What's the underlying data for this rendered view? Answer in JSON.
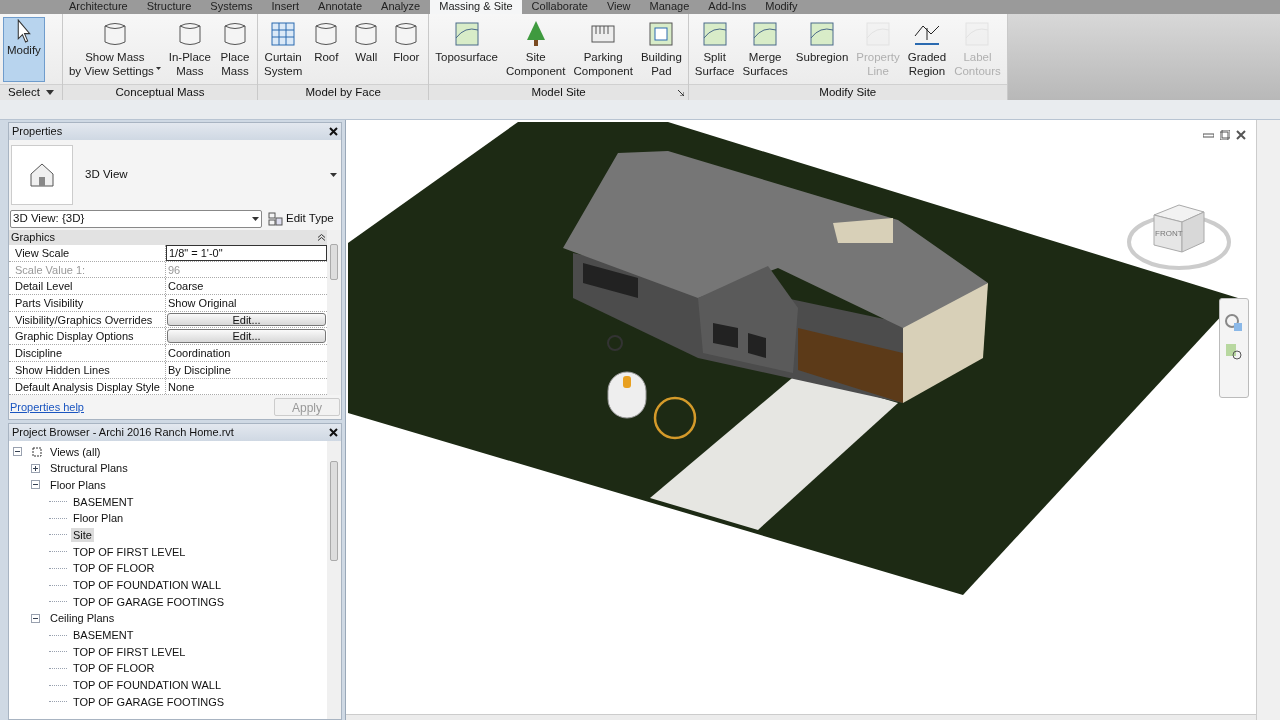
{
  "ribbon_tabs": [
    {
      "label": "Architecture",
      "selected": false
    },
    {
      "label": "Structure",
      "selected": false
    },
    {
      "label": "Systems",
      "selected": false
    },
    {
      "label": "Insert",
      "selected": false
    },
    {
      "label": "Annotate",
      "selected": false
    },
    {
      "label": "Analyze",
      "selected": false
    },
    {
      "label": "Massing & Site",
      "selected": true
    },
    {
      "label": "Collaborate",
      "selected": false
    },
    {
      "label": "View",
      "selected": false
    },
    {
      "label": "Manage",
      "selected": false
    },
    {
      "label": "Add-Ins",
      "selected": false
    },
    {
      "label": "Modify",
      "selected": false
    }
  ],
  "ribbon_panels": [
    {
      "title": "Select",
      "dropdown": true,
      "launcher": false,
      "tools": [
        {
          "lines": [
            "Modify"
          ],
          "selected": true,
          "disabled": false,
          "dropdown": false
        }
      ]
    },
    {
      "title": "Conceptual Mass",
      "dropdown": false,
      "launcher": false,
      "tools": [
        {
          "lines": [
            "Show Mass",
            "by View Settings"
          ],
          "selected": false,
          "disabled": false,
          "dropdown": true
        },
        {
          "lines": [
            "In-Place",
            "Mass"
          ],
          "selected": false,
          "disabled": false,
          "dropdown": false
        },
        {
          "lines": [
            "Place",
            "Mass"
          ],
          "selected": false,
          "disabled": false,
          "dropdown": false
        }
      ]
    },
    {
      "title": "Model by Face",
      "dropdown": false,
      "launcher": false,
      "tools": [
        {
          "lines": [
            "Curtain",
            "System"
          ],
          "selected": false,
          "disabled": false,
          "dropdown": false
        },
        {
          "lines": [
            "Roof"
          ],
          "selected": false,
          "disabled": false,
          "dropdown": false
        },
        {
          "lines": [
            "Wall"
          ],
          "selected": false,
          "disabled": false,
          "dropdown": false
        },
        {
          "lines": [
            "Floor"
          ],
          "selected": false,
          "disabled": false,
          "dropdown": false
        }
      ]
    },
    {
      "title": "Model Site",
      "dropdown": false,
      "launcher": true,
      "tools": [
        {
          "lines": [
            "Toposurface"
          ],
          "selected": false,
          "disabled": false,
          "dropdown": false
        },
        {
          "lines": [
            "Site",
            "Component"
          ],
          "selected": false,
          "disabled": false,
          "dropdown": false
        },
        {
          "lines": [
            "Parking",
            "Component"
          ],
          "selected": false,
          "disabled": false,
          "dropdown": false
        },
        {
          "lines": [
            "Building",
            "Pad"
          ],
          "selected": false,
          "disabled": false,
          "dropdown": false
        }
      ]
    },
    {
      "title": "Modify Site",
      "dropdown": false,
      "launcher": false,
      "tools": [
        {
          "lines": [
            "Split",
            "Surface"
          ],
          "selected": false,
          "disabled": false,
          "dropdown": false
        },
        {
          "lines": [
            "Merge",
            "Surfaces"
          ],
          "selected": false,
          "disabled": false,
          "dropdown": false
        },
        {
          "lines": [
            "Subregion"
          ],
          "selected": false,
          "disabled": false,
          "dropdown": false
        },
        {
          "lines": [
            "Property",
            "Line"
          ],
          "selected": false,
          "disabled": true,
          "dropdown": false
        },
        {
          "lines": [
            "Graded",
            "Region"
          ],
          "selected": false,
          "disabled": false,
          "dropdown": false
        },
        {
          "lines": [
            "Label",
            "Contours"
          ],
          "selected": false,
          "disabled": true,
          "dropdown": false
        }
      ]
    }
  ],
  "properties": {
    "title": "Properties",
    "type_name": "3D View",
    "instance_selector": "3D View: {3D}",
    "edit_type": "Edit Type",
    "group": "Graphics",
    "rows": [
      {
        "label": "View Scale",
        "value": "1/8\" = 1'-0\"",
        "kind": "input",
        "disabled": false
      },
      {
        "label": "Scale Value    1:",
        "value": "96",
        "kind": "text",
        "disabled": true
      },
      {
        "label": "Detail Level",
        "value": "Coarse",
        "kind": "text",
        "disabled": false
      },
      {
        "label": "Parts Visibility",
        "value": "Show Original",
        "kind": "text",
        "disabled": false
      },
      {
        "label": "Visibility/Graphics Overrides",
        "value": "Edit...",
        "kind": "button",
        "disabled": false
      },
      {
        "label": "Graphic Display Options",
        "value": "Edit...",
        "kind": "button",
        "disabled": false
      },
      {
        "label": "Discipline",
        "value": "Coordination",
        "kind": "text",
        "disabled": false
      },
      {
        "label": "Show Hidden Lines",
        "value": "By Discipline",
        "kind": "text",
        "disabled": false
      },
      {
        "label": "Default Analysis Display Style",
        "value": "None",
        "kind": "text",
        "disabled": false
      }
    ],
    "help_link": "Properties help",
    "apply": "Apply"
  },
  "project_browser": {
    "title": "Project Browser - Archi 2016 Ranch Home.rvt",
    "tree": [
      {
        "label": "Views (all)",
        "expanded": true,
        "selected": false,
        "children": [
          {
            "label": "Structural Plans",
            "expanded": false,
            "selected": false
          },
          {
            "label": "Floor Plans",
            "expanded": true,
            "selected": false,
            "children": [
              {
                "label": "BASEMENT",
                "selected": false
              },
              {
                "label": "Floor Plan",
                "selected": false
              },
              {
                "label": "Site",
                "selected": true
              },
              {
                "label": "TOP OF FIRST LEVEL",
                "selected": false
              },
              {
                "label": "TOP OF FLOOR",
                "selected": false
              },
              {
                "label": "TOP OF FOUNDATION WALL",
                "selected": false
              },
              {
                "label": "TOP OF GARAGE FOOTINGS",
                "selected": false
              }
            ]
          },
          {
            "label": "Ceiling Plans",
            "expanded": true,
            "selected": false,
            "children": [
              {
                "label": "BASEMENT",
                "selected": false
              },
              {
                "label": "TOP OF FIRST LEVEL",
                "selected": false
              },
              {
                "label": "TOP OF FLOOR",
                "selected": false
              },
              {
                "label": "TOP OF FOUNDATION WALL",
                "selected": false
              },
              {
                "label": "TOP OF GARAGE FOOTINGS",
                "selected": false
              }
            ]
          }
        ]
      }
    ]
  },
  "viewport": {
    "view_cube": {
      "face_label": "FRONT"
    }
  }
}
